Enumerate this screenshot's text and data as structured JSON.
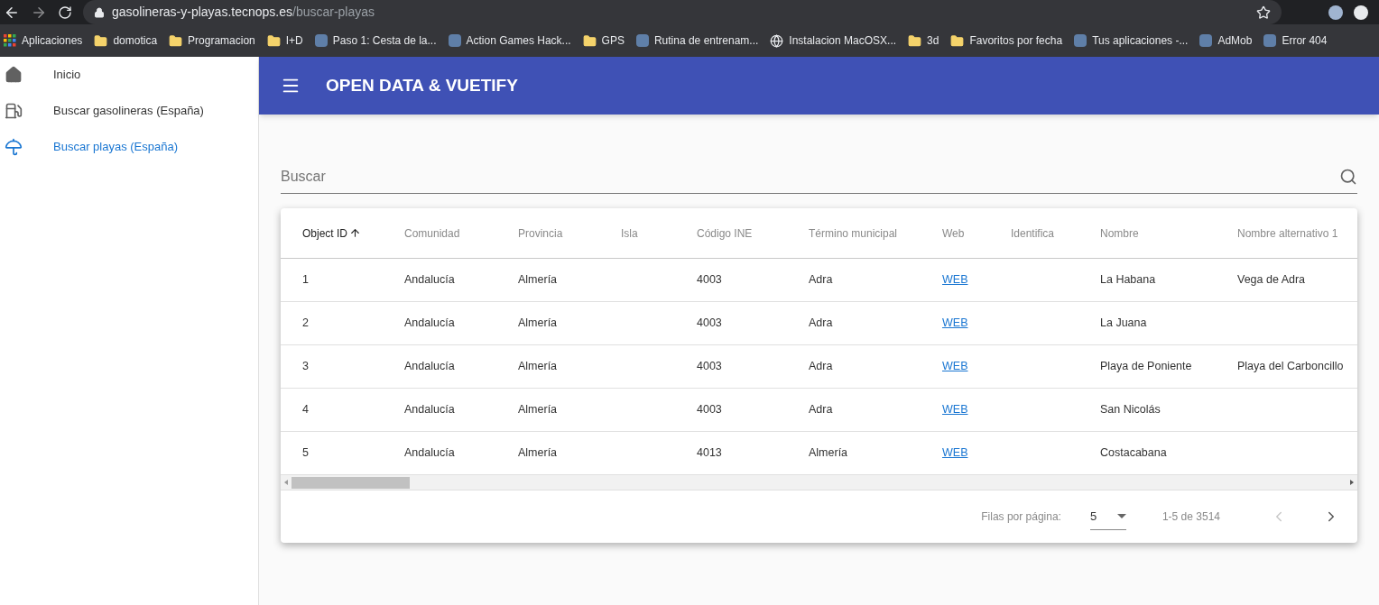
{
  "browser": {
    "url_host": "gasolineras-y-playas.tecnops.es",
    "url_path": "/buscar-playas",
    "bookmarks": [
      {
        "label": "Aplicaciones",
        "kind": "apps"
      },
      {
        "label": "domotica",
        "kind": "folder"
      },
      {
        "label": "Programacion",
        "kind": "folder"
      },
      {
        "label": "I+D",
        "kind": "folder"
      },
      {
        "label": "Paso 1: Cesta de la...",
        "kind": "site"
      },
      {
        "label": "Action Games Hack...",
        "kind": "site"
      },
      {
        "label": "GPS",
        "kind": "folder"
      },
      {
        "label": "Rutina de entrenam...",
        "kind": "site"
      },
      {
        "label": "Instalacion MacOSX...",
        "kind": "globe"
      },
      {
        "label": "3d",
        "kind": "folder"
      },
      {
        "label": "Favoritos por fecha",
        "kind": "folder"
      },
      {
        "label": "Tus aplicaciones -...",
        "kind": "site"
      },
      {
        "label": "AdMob",
        "kind": "site"
      },
      {
        "label": "Error 404",
        "kind": "site"
      }
    ]
  },
  "sidebar": {
    "items": [
      {
        "label": "Inicio",
        "kind": "home",
        "selected": false
      },
      {
        "label": "Buscar gasolineras (España)",
        "kind": "fuel",
        "selected": false
      },
      {
        "label": "Buscar playas (España)",
        "kind": "beach",
        "selected": true
      }
    ]
  },
  "app_bar": {
    "title": "OPEN DATA & VUETIFY"
  },
  "search": {
    "placeholder": "Buscar"
  },
  "table": {
    "columns": [
      {
        "label": "Object ID",
        "sorted": true
      },
      {
        "label": "Comunidad",
        "sorted": false
      },
      {
        "label": "Provincia",
        "sorted": false
      },
      {
        "label": "Isla",
        "sorted": false
      },
      {
        "label": "Código INE",
        "sorted": false
      },
      {
        "label": "Término municipal",
        "sorted": false
      },
      {
        "label": "Web",
        "sorted": false
      },
      {
        "label": "Identifica",
        "sorted": false
      },
      {
        "label": "Nombre",
        "sorted": false
      },
      {
        "label": "Nombre alternativo 1",
        "sorted": false
      }
    ],
    "rows": [
      {
        "object_id": "1",
        "comunidad": "Andalucía",
        "provincia": "Almería",
        "codigo_ine": "4003",
        "termino_municipal": "Adra",
        "web": "WEB",
        "nombre": "La Habana",
        "nombre_alternativo_1": "Vega de Adra"
      },
      {
        "object_id": "2",
        "comunidad": "Andalucía",
        "provincia": "Almería",
        "codigo_ine": "4003",
        "termino_municipal": "Adra",
        "web": "WEB",
        "nombre": "La Juana"
      },
      {
        "object_id": "3",
        "comunidad": "Andalucía",
        "provincia": "Almería",
        "codigo_ine": "4003",
        "termino_municipal": "Adra",
        "web": "WEB",
        "nombre": "Playa de Poniente",
        "nombre_alternativo_1": "Playa del Carboncillo"
      },
      {
        "object_id": "4",
        "comunidad": "Andalucía",
        "provincia": "Almería",
        "codigo_ine": "4003",
        "termino_municipal": "Adra",
        "web": "WEB",
        "nombre": "San Nicolás"
      },
      {
        "object_id": "5",
        "comunidad": "Andalucía",
        "provincia": "Almería",
        "codigo_ine": "4013",
        "termino_municipal": "Almería",
        "web": "WEB",
        "nombre": "Costacabana"
      }
    ],
    "footer": {
      "rows_per_page_label": "Filas por página:",
      "rows_per_page": "5",
      "range": "1-5 de 3514"
    }
  }
}
